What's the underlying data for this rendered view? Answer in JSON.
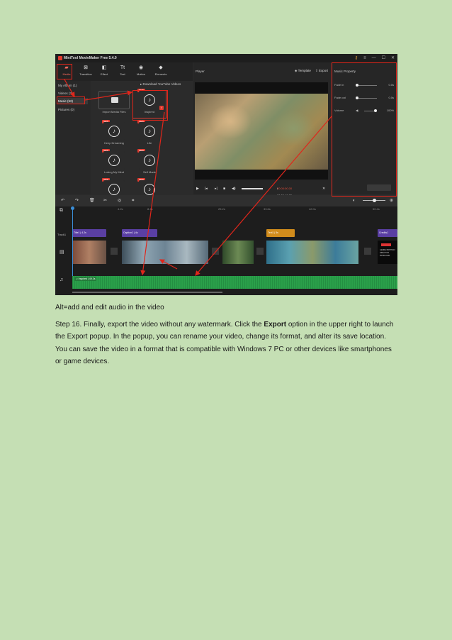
{
  "app": {
    "title": "MiniTool MovieMaker Free 5.4.0",
    "window_controls": [
      "key-icon",
      "menu-icon",
      "minimize-icon",
      "maximize-icon",
      "close-icon"
    ]
  },
  "toolbar": {
    "items": [
      {
        "label": "Media",
        "icon": "folder-icon",
        "active": true
      },
      {
        "label": "Transition",
        "icon": "transition-icon"
      },
      {
        "label": "Effect",
        "icon": "effect-icon"
      },
      {
        "label": "Text",
        "icon": "text-icon"
      },
      {
        "label": "Motion",
        "icon": "motion-icon"
      },
      {
        "label": "Elements",
        "icon": "elements-icon"
      }
    ]
  },
  "media_categories": [
    {
      "label": "My Album (1)"
    },
    {
      "label": "Videos (3)"
    },
    {
      "label": "Music (52)",
      "active": true
    },
    {
      "label": "Pictures (0)"
    }
  ],
  "library": {
    "download_label": "Download YouTube Videos",
    "tiles": [
      {
        "label": "Import Media Files",
        "type": "import"
      },
      {
        "label": "Inspired",
        "new": true,
        "selected": true
      },
      {
        "label": "Keep Dreaming",
        "new": true
      },
      {
        "label": "Life",
        "new": true
      },
      {
        "label": "Losing My Mind",
        "new": true
      },
      {
        "label": "Self Made",
        "new": true
      },
      {
        "label": "",
        "new": true
      },
      {
        "label": "",
        "new": true
      }
    ],
    "new_badge": "NEW"
  },
  "player": {
    "title": "Player",
    "template_label": "Template",
    "export_label": "Export",
    "current_time": "00:00:00.00",
    "total_time": "/ 00:00:49.05",
    "progress": 0
  },
  "music_property": {
    "title": "Music Property",
    "rows": [
      {
        "label": "Fade in",
        "value": "0.0s"
      },
      {
        "label": "Fade out",
        "value": "0.0s"
      },
      {
        "label": "Volume",
        "value": "100%"
      }
    ]
  },
  "timeline": {
    "ruler": [
      "4.2s",
      "8.4s",
      "25.2s",
      "33.6s",
      "42.0s",
      "50.4s"
    ],
    "track_label": "Track1",
    "captions": [
      {
        "label": "Title1 | 4.2s",
        "color": "purple"
      },
      {
        "label": "Caption1 | 4s",
        "color": "purple"
      },
      {
        "label": "Text1 | 5s",
        "color": "orange"
      },
      {
        "label": "Credits1",
        "color": "purple"
      }
    ],
    "audio_label": "Inspired | 49.3s",
    "credits_text": "GENRE BIRTHDAY DIRECTOR PRODUCER"
  },
  "document": {
    "caption": "Alt=add and edit audio in the video",
    "step_before": "Step 16. Finally, export the video without any watermark. Click the ",
    "step_bold": "Export",
    "step_after": " option in the upper right to launch the Export popup. In the popup, you can rename your video, change its format, and alter its save location. You can save the video in a format that is compatible with Windows 7 PC or other devices like smartphones or game devices."
  },
  "colors": {
    "page_background": "#c5dfb4",
    "highlight_red": "#e0261b",
    "audio_green": "#2aa04a",
    "caption_purple": "#5a3fa3",
    "caption_orange": "#d18c1c"
  }
}
